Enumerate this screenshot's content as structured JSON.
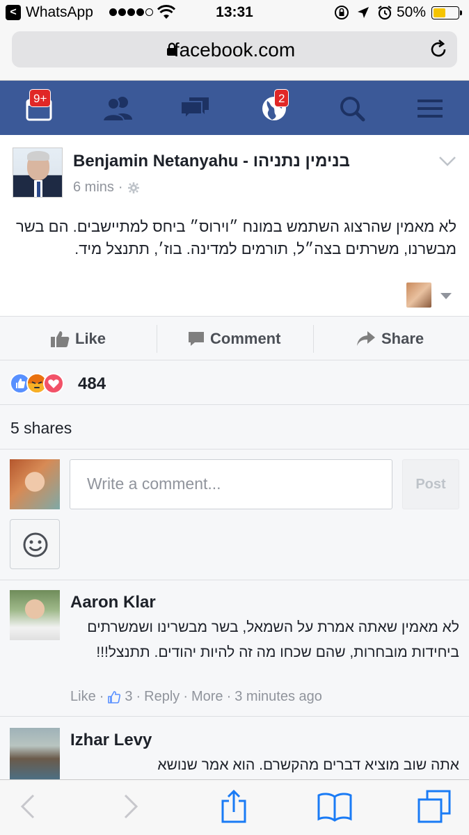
{
  "status_bar": {
    "back_app": "WhatsApp",
    "back_glyph": "<",
    "time": "13:31",
    "battery": "50%",
    "battery_level": 0.5,
    "signal_bars": 4,
    "signal_total": 5
  },
  "safari": {
    "url": "facebook.com",
    "toolbar_icons": [
      "back-icon",
      "forward-icon",
      "share-icon",
      "bookmarks-icon",
      "tabs-icon"
    ]
  },
  "fb_nav": {
    "items": [
      {
        "icon": "friend-requests-icon",
        "badge": "9+"
      },
      {
        "icon": "friends-icon",
        "badge": ""
      },
      {
        "icon": "messages-icon",
        "badge": ""
      },
      {
        "icon": "notifications-globe-icon",
        "badge": "2"
      },
      {
        "icon": "search-icon",
        "badge": ""
      },
      {
        "icon": "menu-icon",
        "badge": ""
      }
    ]
  },
  "post": {
    "author": "Benjamin Netanyahu - בנימין נתניהו",
    "time": "6 mins",
    "separator": "·",
    "body": "לא מאמין שהרצוג השתמש במונח ״וירוס״ ביחס למתיישבים. הם בשר מבשרנו, משרתים בצה״ל, תורמים למדינה. בוז׳, תתנצל מיד."
  },
  "actions": {
    "like": "Like",
    "comment": "Comment",
    "share": "Share"
  },
  "reactions": {
    "count": "484",
    "types": [
      "like",
      "angry",
      "love"
    ]
  },
  "shares": {
    "text": "5 shares"
  },
  "composer": {
    "placeholder": "Write a comment...",
    "post_label": "Post"
  },
  "comments": [
    {
      "name": "Aaron Klar",
      "body": "לא מאמין שאתה אמרת על השמאל, בשר מבשרינו ושמשרתים ביחידות מובחרות, שהם שכחו מה זה להיות יהודים. תתנצל!!!",
      "like": "Like",
      "likes_count": "3",
      "reply": "Reply",
      "more": "More",
      "time": "3 minutes ago"
    },
    {
      "name": "Izhar Levy",
      "body": "אתה שוב מוציא דברים מהקשרם. הוא אמר שנושא"
    }
  ]
}
